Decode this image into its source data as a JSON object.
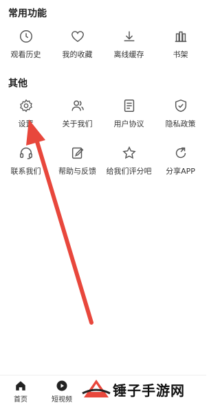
{
  "sections": {
    "common": {
      "title": "常用功能",
      "items": [
        {
          "label": "观看历史",
          "icon": "clock-icon"
        },
        {
          "label": "我的收藏",
          "icon": "heart-icon"
        },
        {
          "label": "离线缓存",
          "icon": "download-icon"
        },
        {
          "label": "书架",
          "icon": "bookshelf-icon"
        }
      ]
    },
    "other": {
      "title": "其他",
      "items": [
        {
          "label": "设置",
          "icon": "gear-icon"
        },
        {
          "label": "关于我们",
          "icon": "users-icon"
        },
        {
          "label": "用户协议",
          "icon": "document-icon"
        },
        {
          "label": "隐私政策",
          "icon": "shield-check-icon"
        },
        {
          "label": "联系我们",
          "icon": "headset-icon"
        },
        {
          "label": "帮助与反馈",
          "icon": "edit-icon"
        },
        {
          "label": "给我们评分吧",
          "icon": "star-icon"
        },
        {
          "label": "分享APP",
          "icon": "share-refresh-icon"
        }
      ]
    }
  },
  "bottom_nav": [
    {
      "label": "首页",
      "icon": "home-icon"
    },
    {
      "label": "短视频",
      "icon": "play-icon"
    }
  ],
  "watermark": {
    "text": "锤子手游网"
  },
  "colors": {
    "arrow": "#e8473c",
    "icon_stroke": "#555555",
    "watermark_logo": "#e8473c"
  }
}
